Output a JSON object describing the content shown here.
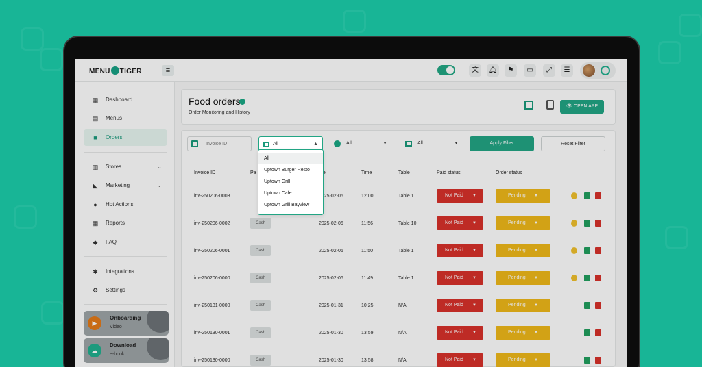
{
  "brand": {
    "logo_text": "MENU TIGER"
  },
  "sidebar": {
    "items": [
      {
        "label": "Dashboard",
        "icon": "dashboard-icon"
      },
      {
        "label": "Menus",
        "icon": "menus-icon"
      },
      {
        "label": "Orders",
        "icon": "orders-icon",
        "active": true
      },
      {
        "label": "Stores",
        "icon": "stores-icon"
      },
      {
        "label": "Marketing",
        "icon": "marketing-icon"
      },
      {
        "label": "Hot Actions",
        "icon": "fire-icon"
      },
      {
        "label": "Reports",
        "icon": "reports-icon"
      },
      {
        "label": "FAQ",
        "icon": "faq-icon"
      },
      {
        "label": "Integrations",
        "icon": "integrations-icon"
      },
      {
        "label": "Settings",
        "icon": "settings-icon"
      }
    ],
    "promos": [
      {
        "title": "Onboarding",
        "subtitle": "Video"
      },
      {
        "title": "Download",
        "subtitle": "e-book"
      }
    ]
  },
  "header": {
    "title": "Food orders",
    "subtitle": "Order Monitoring and History",
    "open_app_label": "OPEN APP"
  },
  "filters": {
    "invoice_placeholder": "Invoice ID",
    "store_value": "All",
    "payment_value": "All",
    "table_value": "All",
    "apply_label": "Apply Filter",
    "reset_label": "Reset Filter",
    "dropdown_options": [
      "All",
      "Uptown Burger Resto",
      "Uptown Grill",
      "Uptown Cafe",
      "Uptown Grill Bayview"
    ]
  },
  "table": {
    "headers": [
      "Invoice ID",
      "Pa",
      "ate",
      "Time",
      "Table",
      "Paid status",
      "Order status"
    ],
    "rows": [
      {
        "invoice": "inv-250206-0003",
        "payment": "",
        "date": "2025-02-06",
        "time": "12:00",
        "table": "Table 1",
        "paid": "Not Paid",
        "status": "Pending"
      },
      {
        "invoice": "inv-250206-0002",
        "payment": "Cash",
        "date": "2025-02-06",
        "time": "11:56",
        "table": "Table 10",
        "paid": "Not Paid",
        "status": "Pending"
      },
      {
        "invoice": "inv-250206-0001",
        "payment": "Cash",
        "date": "2025-02-06",
        "time": "11:50",
        "table": "Table 1",
        "paid": "Not Paid",
        "status": "Pending"
      },
      {
        "invoice": "inv-250206-0000",
        "payment": "Cash",
        "date": "2025-02-06",
        "time": "11:49",
        "table": "Table 1",
        "paid": "Not Paid",
        "status": "Pending"
      },
      {
        "invoice": "inv-250131-0000",
        "payment": "Cash",
        "date": "2025-01-31",
        "time": "10:25",
        "table": "N/A",
        "paid": "Not Paid",
        "status": "Pending"
      },
      {
        "invoice": "inv-250130-0001",
        "payment": "Cash",
        "date": "2025-01-30",
        "time": "13:59",
        "table": "N/A",
        "paid": "Not Paid",
        "status": "Pending"
      },
      {
        "invoice": "inv-250130-0000",
        "payment": "Cash",
        "date": "2025-01-30",
        "time": "13:58",
        "table": "N/A",
        "paid": "Not Paid",
        "status": "Pending"
      }
    ]
  },
  "colors": {
    "accent": "#23a584",
    "background": "#18b596",
    "not_paid": "#d9322b",
    "pending": "#f0b91a"
  }
}
